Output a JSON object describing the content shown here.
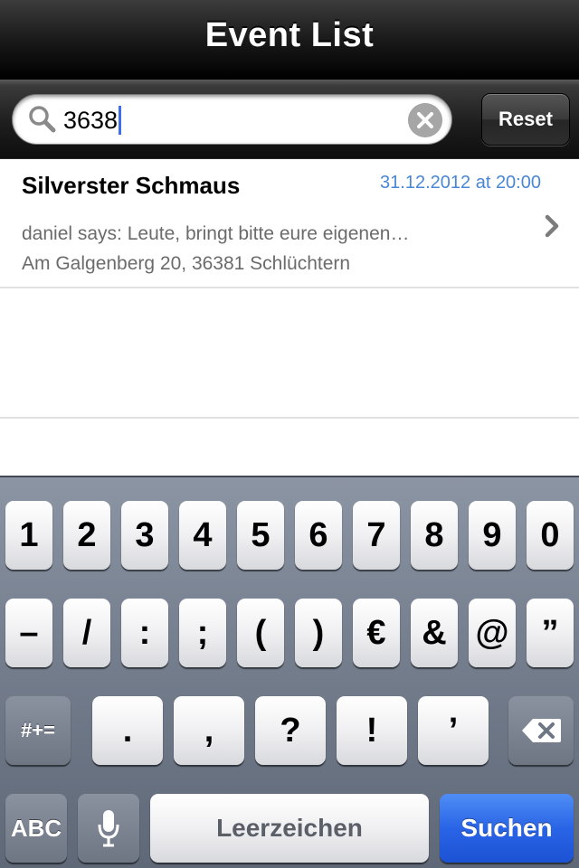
{
  "nav": {
    "title": "Event List"
  },
  "search": {
    "query": "3638",
    "reset_label": "Reset"
  },
  "events": [
    {
      "title": "Silverster Schmaus",
      "date": "31.12.2012 at 20:00",
      "message": "daniel says: Leute, bringt bitte eure eigenen…",
      "address": "Am Galgenberg 20, 36381 Schlüchtern"
    }
  ],
  "keyboard": {
    "row1": [
      "1",
      "2",
      "3",
      "4",
      "5",
      "6",
      "7",
      "8",
      "9",
      "0"
    ],
    "row2": [
      "–",
      "/",
      ":",
      ";",
      "(",
      ")",
      "€",
      "&",
      "@",
      "”"
    ],
    "row3": {
      "shift": "#+=",
      "keys": [
        ".",
        ",",
        "?",
        "!",
        "’"
      ]
    },
    "row4": {
      "abc": "ABC",
      "space": "Leerzeichen",
      "action": "Suchen"
    }
  },
  "colors": {
    "date_blue": "#4a86d4",
    "action_blue": "#2a64e6"
  },
  "icons": {
    "search": "magnifier",
    "clear": "x-circle",
    "chevron": "chevron-right",
    "mic": "microphone",
    "delete": "backspace"
  }
}
